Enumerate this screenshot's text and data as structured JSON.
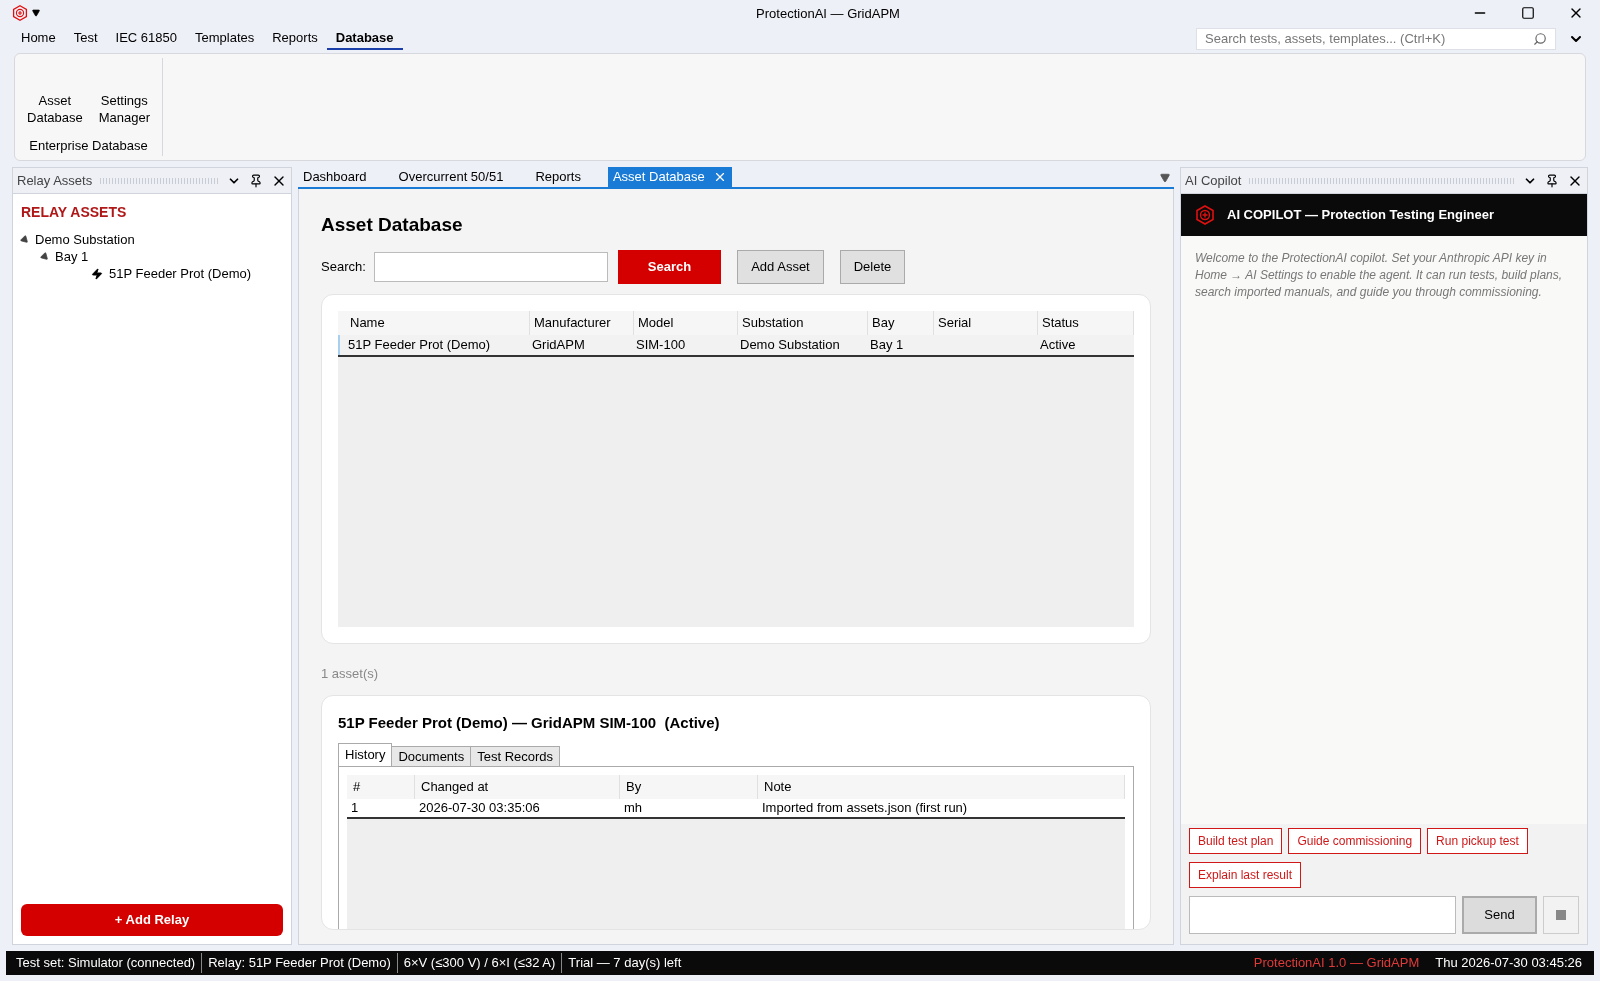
{
  "window": {
    "title": "ProtectionAI — GridAPM"
  },
  "menu": [
    {
      "label": "Home",
      "selected": false
    },
    {
      "label": "Test",
      "selected": false
    },
    {
      "label": "IEC 61850",
      "selected": false
    },
    {
      "label": "Templates",
      "selected": false
    },
    {
      "label": "Reports",
      "selected": false
    },
    {
      "label": "Database",
      "selected": true
    }
  ],
  "global_search": {
    "placeholder": "Search tests, assets, templates... (Ctrl+K)"
  },
  "ribbon": {
    "buttons": [
      "Asset\nDatabase",
      "Settings\nManager"
    ],
    "group_label": "Enterprise Database"
  },
  "left_panel": {
    "title": "Relay Assets",
    "heading": "RELAY ASSETS",
    "tree": [
      {
        "label": "Demo Substation",
        "kind": "folder",
        "expanded": true,
        "children": [
          {
            "label": "Bay 1",
            "kind": "folder",
            "expanded": true,
            "children": [
              {
                "label": "51P Feeder Prot (Demo)",
                "kind": "relay"
              }
            ]
          }
        ]
      }
    ],
    "add_button": "+ Add Relay"
  },
  "doc_tabs": [
    {
      "label": "Dashboard",
      "selected": false
    },
    {
      "label": "Overcurrent 50/51",
      "selected": false
    },
    {
      "label": "Reports",
      "selected": false
    },
    {
      "label": "Asset Database",
      "selected": true
    }
  ],
  "asset_db": {
    "title": "Asset Database",
    "search_label": "Search:",
    "buttons": [
      {
        "label": "Search",
        "kind": "primary"
      },
      {
        "label": "Add Asset",
        "kind": "secondary"
      },
      {
        "label": "Delete",
        "kind": "secondary"
      }
    ],
    "table": {
      "columns": [
        "Name",
        "Manufacturer",
        "Model",
        "Substation",
        "Bay",
        "Serial",
        "Status"
      ],
      "rows": [
        {
          "cells": [
            "51P Feeder Prot (Demo)",
            "GridAPM",
            "SIM-100",
            "Demo Substation",
            "Bay 1",
            "",
            "Active"
          ],
          "selected": true
        }
      ]
    },
    "count": "1 asset(s)",
    "detail": {
      "title": "51P Feeder Prot (Demo) — GridAPM SIM-100  (Active)",
      "tabs": [
        {
          "label": "History",
          "selected": true
        },
        {
          "label": "Documents",
          "selected": false
        },
        {
          "label": "Test Records",
          "selected": false
        }
      ],
      "columns": [
        "#",
        "Changed at",
        "By",
        "Note"
      ],
      "rows": [
        [
          "1",
          "2026-07-30 03:35:06",
          "mh",
          "Imported from assets.json (first run)"
        ]
      ]
    }
  },
  "copilot": {
    "panel_title": "AI Copilot",
    "header": "AI COPILOT — Protection Testing Engineer",
    "welcome": "Welcome to the ProtectionAI copilot. Set your Anthropic API key in Home → AI Settings to enable the agent. It can run tests, build plans, search imported manuals, and guide you through commissioning.",
    "suggestions": [
      "Build test plan",
      "Guide commissioning",
      "Run pickup test",
      "Explain last result"
    ],
    "send": "Send"
  },
  "status_bar": {
    "items": [
      "Test set: Simulator (connected)",
      "Relay: 51P Feeder Prot (Demo)",
      "6×V (≤300 V) / 6×I (≤32 A)",
      "Trial — 7 day(s) left"
    ],
    "product": "ProtectionAI 1.0 — GridAPM",
    "clock": "Thu 2026-07-30 03:45:26"
  }
}
